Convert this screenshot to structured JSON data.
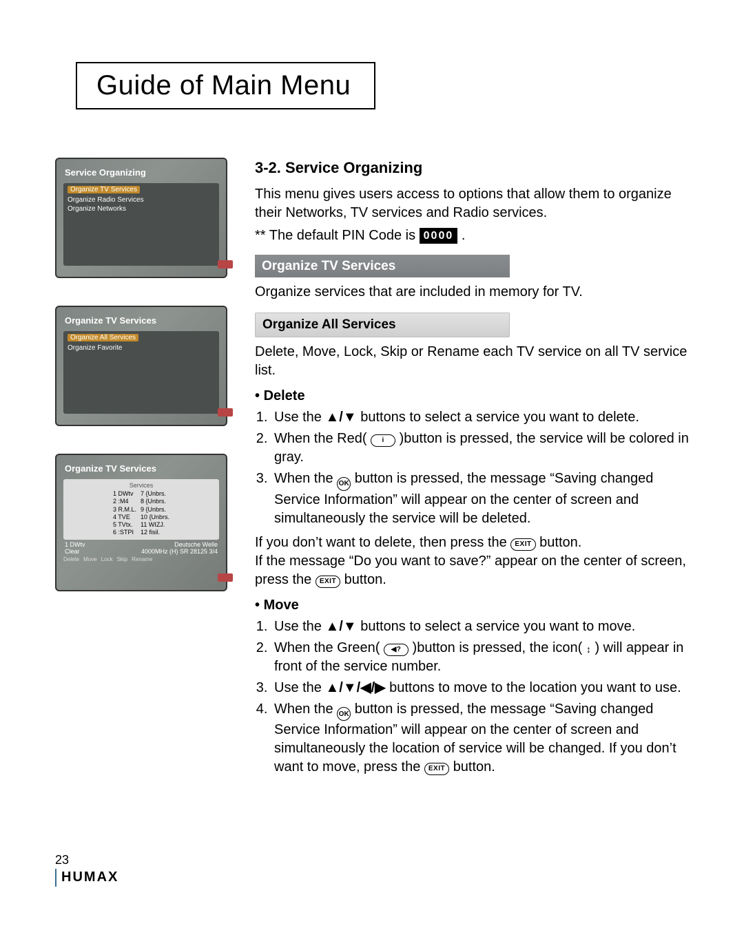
{
  "title": "Guide of Main Menu",
  "page_number": "23",
  "brand": "HUMAX",
  "screenshots": {
    "s1": {
      "title": "Service Organizing",
      "items": [
        "Organize TV Services",
        "Organize Radio Services",
        "Organize Networks"
      ]
    },
    "s2": {
      "title": "Organize TV Services",
      "items": [
        "Organize All Services",
        "Organize Favorite"
      ]
    },
    "s3": {
      "title": "Organize TV Services",
      "subtitle": "Services",
      "left_col": [
        "1 DWtv",
        "2 :M4",
        "3 R.M.L.",
        "4 TVE",
        "5 TVtx.",
        "6 :STPI"
      ],
      "right_col": [
        "7 {Unbrs.",
        "8 {Unbrs.",
        "9 {Unbrs.",
        "10 {Unbrs.",
        "11 WIZJ.",
        "12 fisil."
      ],
      "status_left": "1 DWtv\nClear",
      "status_right": "Deutsche Welle\n4000MHz (H)   SR 28125   3/4",
      "buttons": [
        "Delete",
        "Move",
        "Lock",
        "Skip",
        "Rename"
      ]
    }
  },
  "section": {
    "heading": "3-2. Service Organizing",
    "intro_1": "This menu gives users access to options that allow them to organize their Networks, TV services and Radio services.",
    "intro_2_prefix": "** The default PIN Code is ",
    "pin": "0000",
    "intro_2_suffix": " .",
    "bar_tv": "Organize TV Services",
    "tv_text": "Organize services that are included in memory for TV.",
    "bar_all": "Organize All Services",
    "all_text": "Delete, Move, Lock, Skip or Rename each TV service on all TV service list.",
    "delete": {
      "label": "Delete",
      "s1_a": "Use the ",
      "s1_arrows": "▲/▼",
      "s1_b": " buttons to select a service you want to delete.",
      "s2_a": "When the Red( ",
      "s2_icon": "i",
      "s2_b": " )button is pressed, the service will be colored in gray.",
      "s3_a": "When the ",
      "s3_icon": "OK",
      "s3_b": " button is pressed, the message “Saving changed Service Information” will appear on the center of screen and simultaneously the service will be deleted.",
      "after_1a": "If you don’t want to delete, then press the ",
      "after_1_icon": "EXIT",
      "after_1b": " button.",
      "after_2a": "If the message “Do you want to save?” appear on the center of screen, press the ",
      "after_2_icon": "EXIT",
      "after_2b": " button."
    },
    "move": {
      "label": "Move",
      "s1_a": "Use the ",
      "s1_arrows": "▲/▼",
      "s1_b": " buttons to select a service you want to move.",
      "s2_a": "When the Green( ",
      "s2_icon": "◀?",
      "s2_b": " )button is pressed, the icon( ",
      "s2_icon2": "↕",
      "s2_c": " ) will appear in front of the service number.",
      "s3_a": "Use the ",
      "s3_arrows": "▲/▼/◀/▶",
      "s3_b": " buttons to move to the location you want to use.",
      "s4_a": "When the ",
      "s4_icon": "OK",
      "s4_b": " button is pressed, the message “Saving changed Service Information” will appear on the center of screen and simultaneously the location of service will be changed. If you don’t want to move, press the ",
      "s4_icon2": "EXIT",
      "s4_c": " button."
    }
  }
}
